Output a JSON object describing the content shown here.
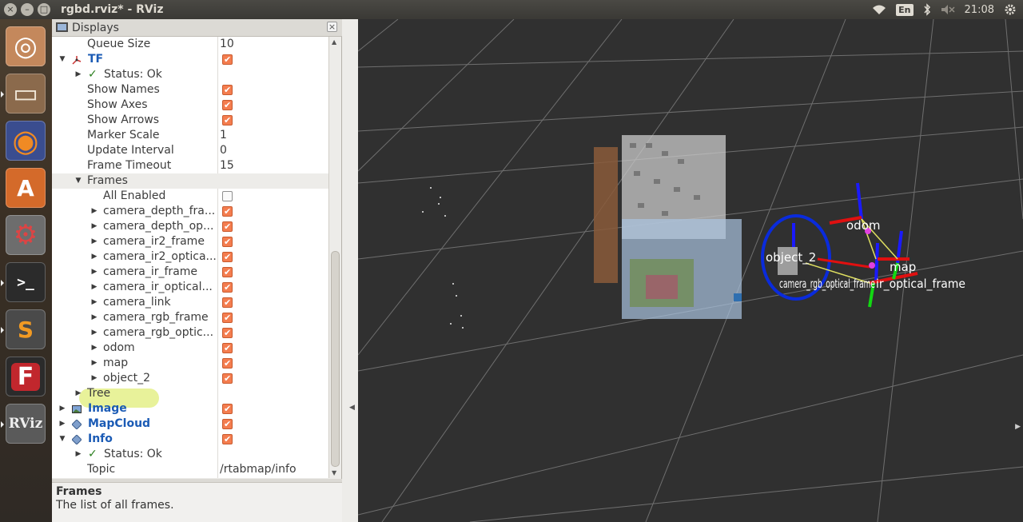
{
  "window": {
    "title": "rgbd.rviz* - RViz",
    "close_glyph": "×",
    "minimize_glyph": "–",
    "maximize_glyph": "□"
  },
  "tray": {
    "wifi_icon": "wifi-icon",
    "keyboard_lang": "En",
    "bluetooth_icon": "bluetooth-icon",
    "volume_icon": "volume-muted-icon",
    "time": "21:08",
    "settings_icon": "gear-icon"
  },
  "launcher": {
    "items": [
      {
        "name": "ubuntu-dash",
        "glyph": "◎"
      },
      {
        "name": "files",
        "glyph": "▭"
      },
      {
        "name": "firefox",
        "glyph": "◉"
      },
      {
        "name": "software-center",
        "glyph": "A"
      },
      {
        "name": "system-settings",
        "glyph": "⚙"
      },
      {
        "name": "terminal",
        "glyph": ">_"
      },
      {
        "name": "sublime-text",
        "glyph": "S"
      },
      {
        "name": "fritzing",
        "glyph": "F"
      },
      {
        "name": "rviz",
        "glyph": "RViz"
      }
    ]
  },
  "displays": {
    "title": "Displays",
    "close_glyph": "×",
    "rows": [
      {
        "label": "Queue Size",
        "value": "10"
      },
      {
        "label": "TF",
        "checked": true
      },
      {
        "label": "Status: Ok"
      },
      {
        "label": "Show Names",
        "checked": true
      },
      {
        "label": "Show Axes",
        "checked": true
      },
      {
        "label": "Show Arrows",
        "checked": true
      },
      {
        "label": "Marker Scale",
        "value": "1"
      },
      {
        "label": "Update Interval",
        "value": "0"
      },
      {
        "label": "Frame Timeout",
        "value": "15"
      },
      {
        "label": "Frames"
      },
      {
        "label": "All Enabled",
        "checked": false
      },
      {
        "label": "camera_depth_fra...",
        "checked": true
      },
      {
        "label": "camera_depth_op...",
        "checked": true
      },
      {
        "label": "camera_ir2_frame",
        "checked": true
      },
      {
        "label": "camera_ir2_optica...",
        "checked": true
      },
      {
        "label": "camera_ir_frame",
        "checked": true
      },
      {
        "label": "camera_ir_optical...",
        "checked": true
      },
      {
        "label": "camera_link",
        "checked": true
      },
      {
        "label": "camera_rgb_frame",
        "checked": true
      },
      {
        "label": "camera_rgb_optic...",
        "checked": true
      },
      {
        "label": "odom",
        "checked": true
      },
      {
        "label": "map",
        "checked": true
      },
      {
        "label": "object_2",
        "checked": true
      },
      {
        "label": "Tree"
      },
      {
        "label": "Image",
        "checked": true
      },
      {
        "label": "MapCloud",
        "checked": true
      },
      {
        "label": "Info",
        "checked": true
      },
      {
        "label": "Status: Ok"
      },
      {
        "label": "Topic",
        "value": "/rtabmap/info"
      }
    ]
  },
  "help": {
    "title": "Frames",
    "text": "The list of all frames."
  },
  "viewport": {
    "labels": {
      "odom": "odom",
      "map": "map",
      "object": "object_2",
      "camera_cluster": "camera_rgb_optical_frame",
      "camera_cluster_right": "ir_optical_frame"
    },
    "grid_color": "#6f6f6f",
    "background_color": "#303030",
    "highlight_circle_color": "#0a2bdc"
  }
}
